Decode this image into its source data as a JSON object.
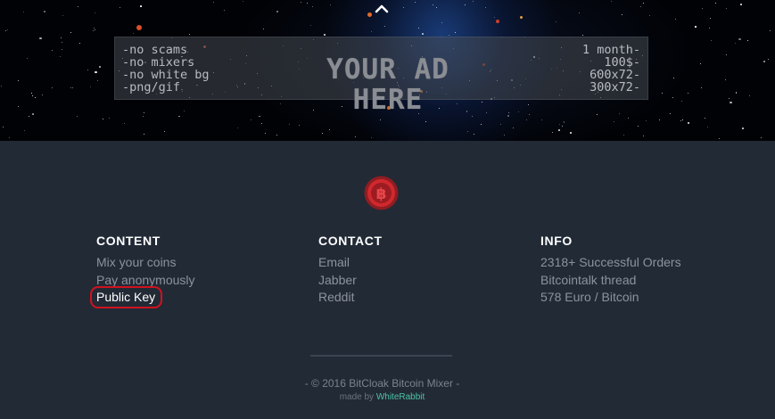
{
  "banner": {
    "scroll_top_icon": "chevron-up-icon",
    "ad": {
      "title": "YOUR AD HERE",
      "left_lines": [
        "-no scams",
        "-no mixers",
        "-no white bg",
        "-png/gif"
      ],
      "right_lines": [
        "1 month-",
        "100$-",
        "600x72-",
        "300x72-"
      ]
    }
  },
  "footer": {
    "logo_icon": "bitcoin-icon",
    "columns": [
      {
        "title": "CONTENT",
        "links": [
          "Mix your coins",
          "Pay anonymously",
          "Public Key"
        ]
      },
      {
        "title": "CONTACT",
        "links": [
          "Email",
          "Jabber",
          "Reddit"
        ]
      },
      {
        "title": "INFO",
        "links": [
          "2318+ Successful Orders",
          "Bitcointalk thread",
          "578 Euro / Bitcoin"
        ]
      }
    ],
    "copyright": "- © 2016 BitCloak Bitcoin Mixer -",
    "made_by_prefix": "made by",
    "made_by_name": "WhiteRabbit"
  },
  "colors": {
    "footer_bg": "#222a36",
    "link": "#8c939e",
    "highlight": "#d0121f",
    "brand_red": "#c8282e",
    "credit_link": "#4ec3a4"
  }
}
